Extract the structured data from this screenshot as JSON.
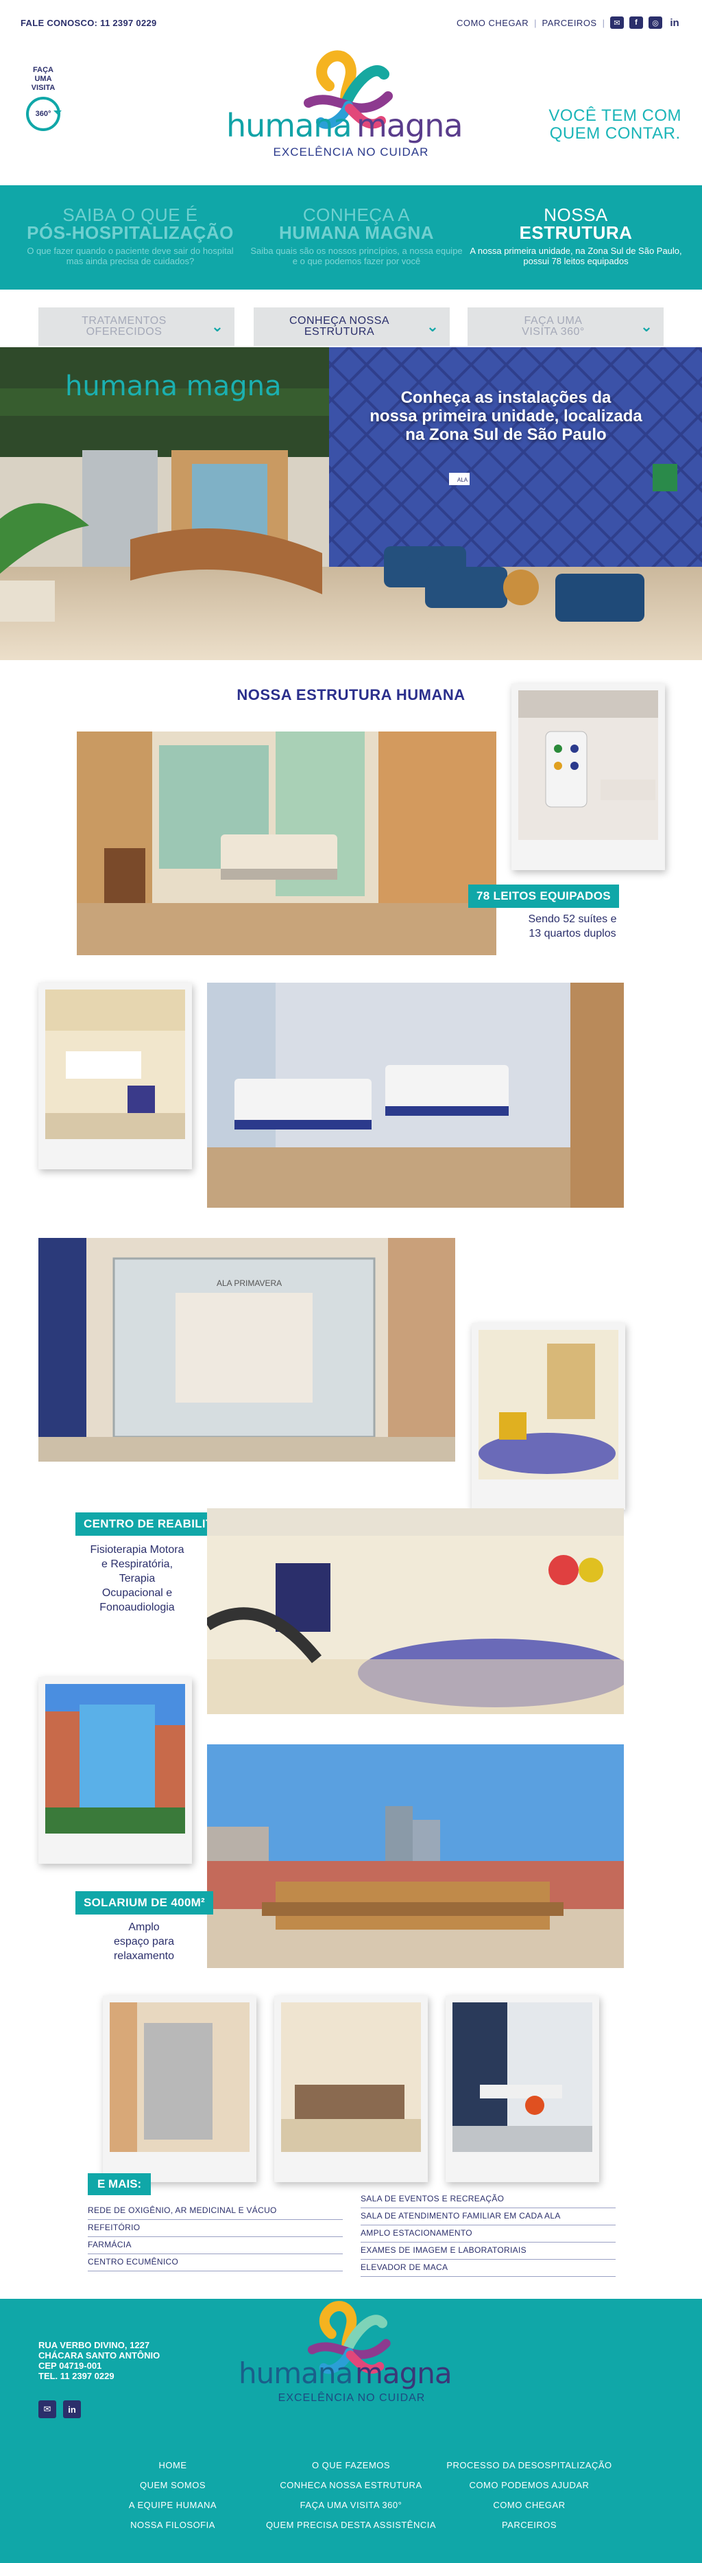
{
  "topbar": {
    "call": "FALE CONOSCO: 11 2397 0229",
    "links": [
      "COMO CHEGAR",
      "PARCEIROS"
    ],
    "social_icons": [
      "mail-icon",
      "facebook-icon",
      "instagram-icon",
      "linkedin-icon"
    ]
  },
  "header": {
    "visit": {
      "line1": "FAÇA",
      "line2": "UMA",
      "line3": "VISITA",
      "badge": "360°"
    },
    "logo": {
      "word1": "humana",
      "word2": "magna",
      "tagline": "EXCELÊNCIA NO CUIDAR"
    },
    "slogan": {
      "line1": "VOCÊ TEM COM",
      "line2": "QUEM CONTAR."
    }
  },
  "band": [
    {
      "light": "SAIBA O QUE É",
      "bold": "PÓS-HOSPITALIZAÇÃO",
      "text": "O que fazer quando o paciente deve sair do hospital mas ainda precisa de cuidados?"
    },
    {
      "light": "CONHEÇA A",
      "bold": "HUMANA MAGNA",
      "text": "Saiba quais são os nossos princípios, a nossa equipe e o que podemos fazer por você"
    },
    {
      "light": "NOSSA",
      "bold": "ESTRUTURA",
      "text": "A nossa primeira unidade, na Zona Sul de São Paulo, possui 78 leitos equipados"
    }
  ],
  "tabs": [
    {
      "line1": "TRATAMENTOS",
      "line2": "OFERECIDOS"
    },
    {
      "line1": "CONHEÇA NOSSA",
      "line2": "ESTRUTURA"
    },
    {
      "line1": "FAÇA UMA",
      "line2": "VISITA 360°"
    }
  ],
  "hero": {
    "caption1": "Conheça as instalações da",
    "caption2": "nossa primeira unidade, localizada",
    "caption3": "na Zona Sul de São Paulo",
    "wall_logo": "humana magna",
    "door_sign": "ALA"
  },
  "section_title": "NOSSA ESTRUTURA HUMANA",
  "beds": {
    "badge": "78 LEITOS EQUIPADOS",
    "line1": "Sendo 52 suítes e",
    "line2": "13 quartos duplos"
  },
  "reab": {
    "badge": "CENTRO DE REABILITAÇÃO",
    "line1": "Fisioterapia Motora",
    "line2": "e Respiratória,",
    "line3": "Terapia",
    "line4": "Ocupacional e",
    "line5": "Fonoaudiologia"
  },
  "glass_sign": "ALA PRIMAVERA",
  "solarium": {
    "badge": "SOLARIUM DE 400M²",
    "line1": "Amplo",
    "line2": "espaço para",
    "line3": "relaxamento"
  },
  "mais": {
    "badge": "E MAIS:",
    "left": [
      "REDE DE OXIGÊNIO, AR MEDICINAL E VÁCUO",
      "REFEITÓRIO",
      "FARMÁCIA",
      "CENTRO ECUMÊNICO"
    ],
    "right": [
      "SALA DE EVENTOS E RECREAÇÃO",
      "SALA DE ATENDIMENTO FAMILIAR EM CADA ALA",
      "AMPLO ESTACIONAMENTO",
      "EXAMES DE IMAGEM E LABORATORIAIS",
      "ELEVADOR DE MACA"
    ]
  },
  "footer": {
    "address": [
      "RUA VERBO DIVINO, 1227",
      "CHÁCARA SANTO ANTÔNIO",
      "CEP 04719-001",
      "TEL. 11 2397 0229"
    ],
    "logo": {
      "word1": "humana",
      "word2": "magna",
      "tagline": "EXCELÊNCIA NO CUIDAR"
    },
    "nav_col1": [
      "HOME",
      "QUEM SOMOS",
      "A EQUIPE HUMANA",
      "NOSSA FILOSOFIA"
    ],
    "nav_col2": [
      "O QUE FAZEMOS",
      "CONHECA NOSSA ESTRUTURA",
      "FAÇA UMA VISITA 360°",
      "QUEM PRECISA DESTA ASSISTÊNCIA"
    ],
    "nav_col3": [
      "PROCESSO DA DESOSPITALIZAÇÃO",
      "COMO PODEMOS AJUDAR",
      "COMO CHEGAR",
      "PARCEIROS"
    ]
  },
  "colors": {
    "teal": "#10a7a8",
    "navy": "#2b2f6b",
    "purple": "#5a3d8c"
  }
}
